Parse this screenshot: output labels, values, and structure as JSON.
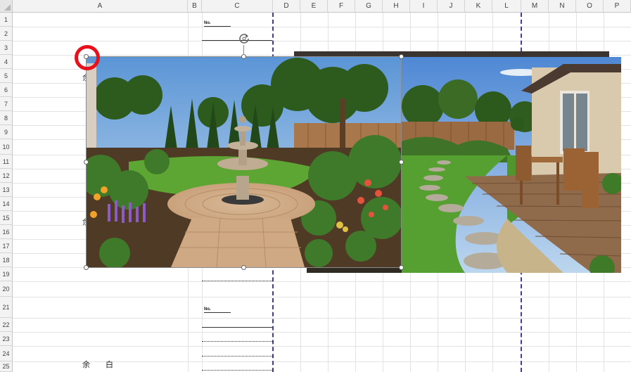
{
  "spreadsheet": {
    "columns": [
      "A",
      "B",
      "C",
      "D",
      "E",
      "F",
      "G",
      "H",
      "I",
      "J",
      "K",
      "L",
      "M",
      "N",
      "O",
      "P"
    ],
    "rows": [
      "1",
      "2",
      "3",
      "4",
      "5",
      "6",
      "7",
      "8",
      "9",
      "10",
      "11",
      "12",
      "13",
      "14",
      "15",
      "16",
      "17",
      "18",
      "19",
      "20",
      "21",
      "22",
      "23",
      "24",
      "25"
    ]
  },
  "cells": {
    "no_label_top": "No.",
    "no_label_bottom": "No.",
    "yohaku_bottom": "余　　白",
    "partial_top": "余",
    "partial_mid": "余"
  },
  "images": {
    "left": "garden-fountain-photo",
    "right": "garden-patio-photo"
  },
  "colors": {
    "page_break": "#3a3ab8",
    "highlight_ring": "#e8111b",
    "header_bg": "#f3f3f3"
  }
}
